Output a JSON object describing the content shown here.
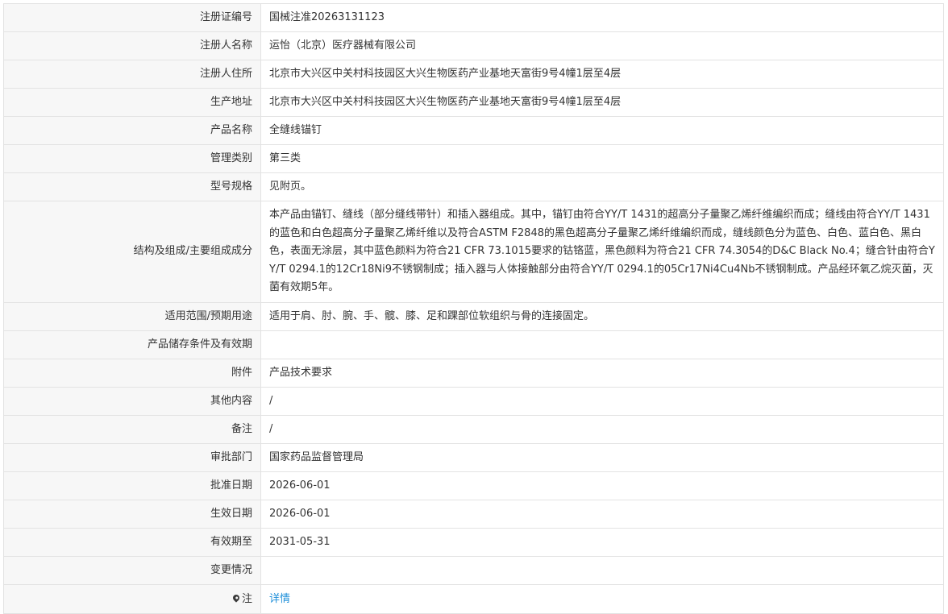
{
  "rows": [
    {
      "label": "注册证编号",
      "value": "国械注准20263131123"
    },
    {
      "label": "注册人名称",
      "value": "运怡（北京）医疗器械有限公司"
    },
    {
      "label": "注册人住所",
      "value": "北京市大兴区中关村科技园区大兴生物医药产业基地天富街9号4幢1层至4层"
    },
    {
      "label": "生产地址",
      "value": "北京市大兴区中关村科技园区大兴生物医药产业基地天富街9号4幢1层至4层"
    },
    {
      "label": "产品名称",
      "value": "全缝线锚钉"
    },
    {
      "label": "管理类别",
      "value": "第三类"
    },
    {
      "label": "型号规格",
      "value": "见附页。"
    },
    {
      "label": "结构及组成/主要组成成分",
      "value": "本产品由锚钉、缝线（部分缝线带针）和插入器组成。其中，锚钉由符合YY/T 1431的超高分子量聚乙烯纤维编织而成；缝线由符合YY/T 1431的蓝色和白色超高分子量聚乙烯纤维以及符合ASTM F2848的黑色超高分子量聚乙烯纤维编织而成，缝线颜色分为蓝色、白色、蓝白色、黑白色，表面无涂层，其中蓝色颜料为符合21 CFR 73.1015要求的钴铬蓝，黑色颜料为符合21 CFR 74.3054的D&C Black No.4；缝合针由符合YY/T 0294.1的12Cr18Ni9不锈钢制成；插入器与人体接触部分由符合YY/T 0294.1的05Cr17Ni4Cu4Nb不锈钢制成。产品经环氧乙烷灭菌，灭菌有效期5年。"
    },
    {
      "label": "适用范围/预期用途",
      "value": "适用于肩、肘、腕、手、髋、膝、足和踝部位软组织与骨的连接固定。"
    },
    {
      "label": "产品储存条件及有效期",
      "value": ""
    },
    {
      "label": "附件",
      "value": "产品技术要求"
    },
    {
      "label": "其他内容",
      "value": "/"
    },
    {
      "label": "备注",
      "value": "/"
    },
    {
      "label": "审批部门",
      "value": "国家药品监督管理局"
    },
    {
      "label": "批准日期",
      "value": "2026-06-01"
    },
    {
      "label": "生效日期",
      "value": "2026-06-01"
    },
    {
      "label": "有效期至",
      "value": "2031-05-31"
    },
    {
      "label": "变更情况",
      "value": ""
    }
  ],
  "note": {
    "label": "注",
    "icon": "map-pin-icon",
    "link_text": "详情",
    "link_color": "#1e8fd9"
  }
}
